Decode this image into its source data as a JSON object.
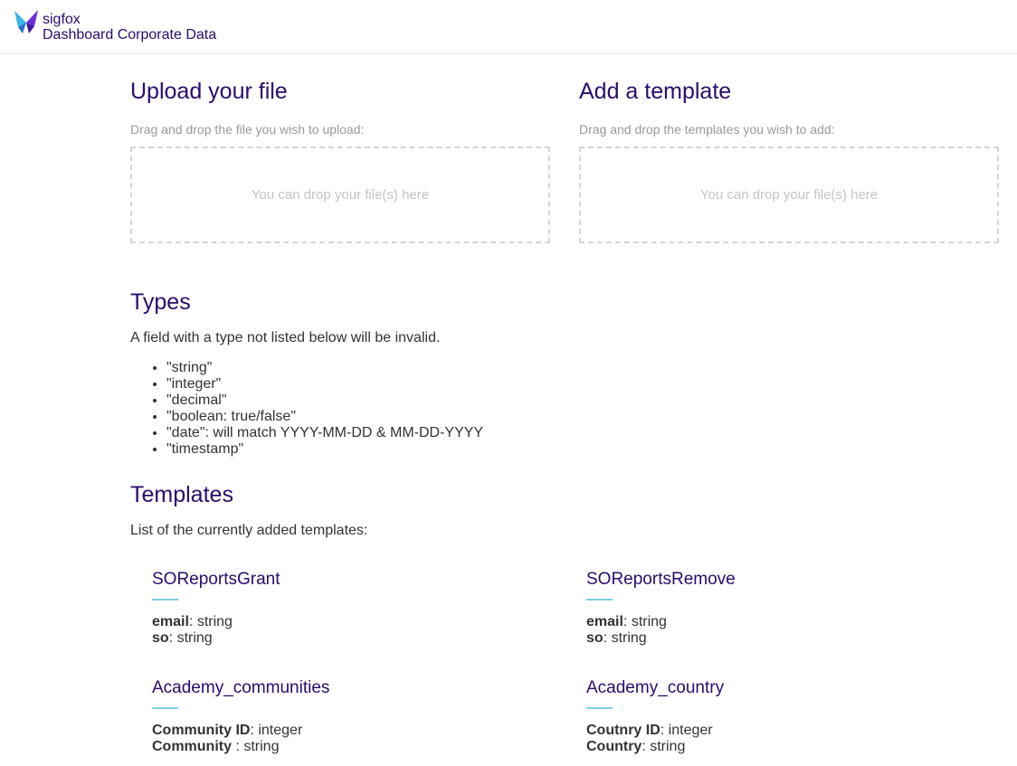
{
  "header": {
    "brand": "sigfox",
    "subtitle": "Dashboard Corporate Data"
  },
  "upload": {
    "title": "Upload your file",
    "hint": "Drag and drop the file you wish to upload:",
    "dropzone": "You can drop your file(s) here"
  },
  "add_template": {
    "title": "Add a template",
    "hint": "Drag and drop the templates you wish to add:",
    "dropzone": "You can drop your file(s) here"
  },
  "types": {
    "title": "Types",
    "description": "A field with a type not listed below will be invalid.",
    "items": [
      "\"string\"",
      "\"integer\"",
      "\"decimal\"",
      "\"boolean: true/false\"",
      "\"date\": will match YYYY-MM-DD & MM-DD-YYYY",
      "\"timestamp\""
    ]
  },
  "templates": {
    "title": "Templates",
    "description": "List of the currently added templates:",
    "list": [
      {
        "name": "SOReportsGrant",
        "fields": [
          {
            "key": "email",
            "sep": ": ",
            "type": "string"
          },
          {
            "key": "so",
            "sep": ": ",
            "type": "string"
          }
        ]
      },
      {
        "name": "SOReportsRemove",
        "fields": [
          {
            "key": "email",
            "sep": ": ",
            "type": "string"
          },
          {
            "key": "so",
            "sep": ": ",
            "type": "string"
          }
        ]
      },
      {
        "name": "Academy_communities",
        "fields": [
          {
            "key": "Community ID",
            "sep": ": ",
            "type": "integer"
          },
          {
            "key": "Community ",
            "sep": ": ",
            "type": "string"
          }
        ]
      },
      {
        "name": "Academy_country",
        "fields": [
          {
            "key": "Coutnry ID",
            "sep": ": ",
            "type": "integer"
          },
          {
            "key": "Country",
            "sep": ": ",
            "type": "string"
          }
        ]
      }
    ]
  },
  "colors": {
    "accent": "#2b0b6e",
    "underline": "#7ecfe0",
    "logo_blue": "#35b6e8",
    "logo_purple": "#6a2fd6"
  },
  "icons": {
    "logo": "sigfox-butterfly-logo"
  }
}
